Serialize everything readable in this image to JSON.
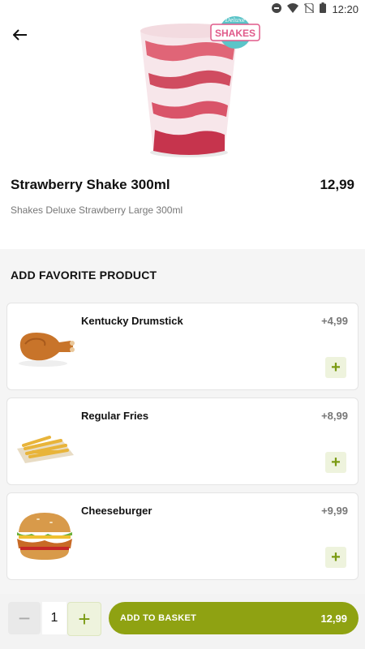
{
  "status": {
    "time": "12:20"
  },
  "product": {
    "title": "Strawberry Shake 300ml",
    "price": "12,99",
    "description": "Shakes Deluxe Strawberry Large 300ml",
    "badge_top": "Deluxe",
    "badge_main": "SHAKES"
  },
  "section": {
    "title": "ADD FAVORITE PRODUCT",
    "items": [
      {
        "name": "Kentucky Drumstick",
        "price": "+4,99",
        "icon": "drumstick-icon"
      },
      {
        "name": "Regular Fries",
        "price": "+8,99",
        "icon": "fries-icon"
      },
      {
        "name": "Cheeseburger",
        "price": "+9,99",
        "icon": "burger-icon"
      }
    ],
    "add_label": "+"
  },
  "bottom": {
    "minus": "−",
    "quantity": "1",
    "plus": "+",
    "add_label": "ADD TO BASKET",
    "total": "12,99"
  },
  "colors": {
    "accent": "#8fa212",
    "accent_light": "#eef3dd",
    "badge": "#5bc4c8"
  }
}
